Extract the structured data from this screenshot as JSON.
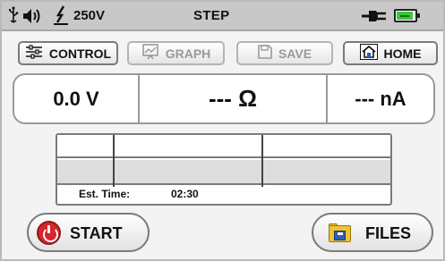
{
  "status_bar": {
    "usb_icon": "usb-icon",
    "sound_icon": "speaker-icon",
    "hv_icon": "high-voltage-icon",
    "voltage": "250V",
    "mode": "STEP",
    "power_icon": "power-plug-icon",
    "battery_icon": "battery-icon",
    "battery_color": "#39c739"
  },
  "toolbar": {
    "control_label": "CONTROL",
    "graph_label": "GRAPH",
    "save_label": "SAVE",
    "home_label": "HOME"
  },
  "measurement": {
    "voltage": "0.0 V",
    "resistance": "--- Ω",
    "current": "--- nA"
  },
  "timing": {
    "est_label": "Est. Time:",
    "est_value": "02:30"
  },
  "actions": {
    "start_label": "START",
    "files_label": "FILES",
    "start_icon_color": "#d8262a"
  }
}
